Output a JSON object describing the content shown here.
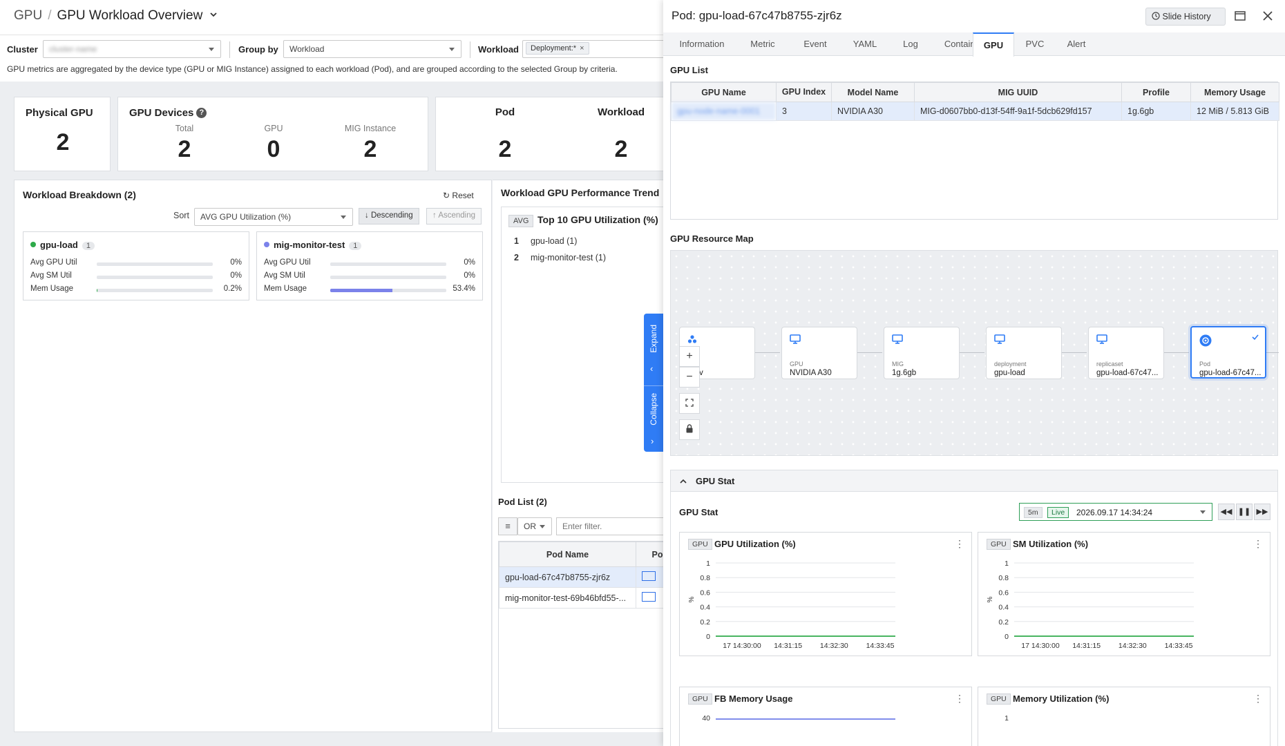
{
  "breadcrumb": {
    "root": "GPU",
    "separator": "/",
    "current": "GPU Workload Overview"
  },
  "filters": {
    "cluster_label": "Cluster",
    "cluster_value": "cluster-name",
    "groupby_label": "Group by",
    "groupby_value": "Workload",
    "workload_label": "Workload",
    "workload_chip": "Deployment:*",
    "chip_close": "×"
  },
  "description": "GPU metrics are aggregated by the device type (GPU or MIG Instance) assigned to each workload (Pod), and are grouped according to the selected Group by criteria.",
  "summary": {
    "physical_gpu": {
      "title": "Physical GPU",
      "value": "2"
    },
    "gpu_devices": {
      "title": "GPU Devices",
      "help": "?",
      "items": [
        {
          "label": "Total",
          "value": "2"
        },
        {
          "label": "GPU",
          "value": "0"
        },
        {
          "label": "MIG Instance",
          "value": "2"
        }
      ]
    },
    "pod": {
      "title": "Pod",
      "value": "2"
    },
    "workload": {
      "title": "Workload",
      "value": "2"
    }
  },
  "breakdown": {
    "title": "Workload Breakdown (2)",
    "reset": "Reset",
    "sort_label": "Sort",
    "sort_value": "AVG GPU Utilization (%)",
    "descending": "Descending",
    "ascending": "Ascending",
    "cards": [
      {
        "name": "gpu-load",
        "count": "1",
        "dot_color": "#2eaa4a",
        "metrics": [
          {
            "label": "Avg GPU Util",
            "value": "0%",
            "fraction": 0.0
          },
          {
            "label": "Avg SM Util",
            "value": "0%",
            "fraction": 0.0
          },
          {
            "label": "Mem Usage",
            "value": "0.2%",
            "fraction": 0.006
          }
        ]
      },
      {
        "name": "mig-monitor-test",
        "count": "1",
        "dot_color": "#7b82ea",
        "metrics": [
          {
            "label": "Avg GPU Util",
            "value": "0%",
            "fraction": 0.0
          },
          {
            "label": "Avg SM Util",
            "value": "0%",
            "fraction": 0.0
          },
          {
            "label": "Mem Usage",
            "value": "53.4%",
            "fraction": 0.534
          }
        ]
      }
    ]
  },
  "trend": {
    "title": "Workload GPU Performance Trend",
    "avg_tag": "AVG",
    "subtitle": "Top 10 GPU Utilization (%)",
    "items": [
      {
        "rank": "1",
        "name": "gpu-load (1)"
      },
      {
        "rank": "2",
        "name": "mig-monitor-test (1)"
      }
    ]
  },
  "side_tabs": {
    "expand": "Expand",
    "collapse": "Collapse"
  },
  "pod_list": {
    "title": "Pod List (2)",
    "logic": "OR",
    "filter_placeholder": "Enter filter.",
    "columns": [
      "Pod Name",
      "Po"
    ],
    "rows": [
      "gpu-load-67c47b8755-zjr6z",
      "mig-monitor-test-69b46bfd55-..."
    ]
  },
  "drawer": {
    "title": "Pod: gpu-load-67c47b8755-zjr6z",
    "slide_history": "Slide History",
    "tabs": [
      "Information",
      "Metric",
      "Event",
      "YAML",
      "Log",
      "Container",
      "GPU",
      "PVC",
      "Alert"
    ],
    "active_tab": "GPU",
    "gpu_list": {
      "title": "GPU List",
      "columns": [
        "GPU Name",
        "GPU Index",
        "Model Name",
        "MIG UUID",
        "Profile",
        "Memory Usage"
      ],
      "rows": [
        [
          "gpu-node-name-0001",
          "3",
          "NVIDIA A30",
          "MIG-d0607bb0-d13f-54ff-9a1f-5dcb629fd157",
          "1g.6gb",
          "12 MiB / 5.813 GiB"
        ]
      ]
    },
    "resource_map": {
      "title": "GPU Resource Map",
      "nodes": [
        {
          "label": "",
          "value": "v",
          "icon": "cluster-icon"
        },
        {
          "label": "GPU",
          "value": "NVIDIA A30",
          "icon": "monitor-icon"
        },
        {
          "label": "MIG",
          "value": "1g.6gb",
          "icon": "monitor-icon"
        },
        {
          "label": "deployment",
          "value": "gpu-load",
          "icon": "monitor-icon"
        },
        {
          "label": "replicaset",
          "value": "gpu-load-67c47...",
          "icon": "monitor-icon"
        },
        {
          "label": "Pod",
          "value": "gpu-load-67c47...",
          "icon": "kubernetes-icon"
        }
      ],
      "zoom_in": "+",
      "zoom_out": "−"
    },
    "gpu_stat": {
      "section_title": "GPU Stat",
      "inner_title": "GPU Stat",
      "range": "5m",
      "live": "Live",
      "time": "2026.09.17 14:34:24",
      "charts": [
        {
          "tag": "GPU",
          "title": "GPU Utilization (%)"
        },
        {
          "tag": "GPU",
          "title": "SM Utilization (%)"
        },
        {
          "tag": "GPU",
          "title": "FB Memory Usage"
        },
        {
          "tag": "GPU",
          "title": "Memory Utilization (%)"
        }
      ]
    }
  },
  "chart_data": [
    {
      "type": "line",
      "title": "GPU Utilization (%)",
      "ylabel": "%",
      "ylim": [
        0,
        1
      ],
      "yticks": [
        "1",
        "0.8",
        "0.6",
        "0.4",
        "0.2",
        "0"
      ],
      "xticks": [
        "17 14:30:00",
        "14:31:15",
        "14:32:30",
        "14:33:45"
      ],
      "series": [
        {
          "color": "#2eaa4a",
          "values": [
            0,
            0,
            0,
            0,
            0,
            0
          ]
        }
      ]
    },
    {
      "type": "line",
      "title": "SM Utilization (%)",
      "ylabel": "%",
      "ylim": [
        0,
        1
      ],
      "yticks": [
        "1",
        "0.8",
        "0.6",
        "0.4",
        "0.2",
        "0"
      ],
      "xticks": [
        "17 14:30:00",
        "14:31:15",
        "14:32:30",
        "14:33:45"
      ],
      "series": [
        {
          "color": "#2eaa4a",
          "values": [
            0,
            0,
            0,
            0,
            0,
            0
          ]
        }
      ]
    },
    {
      "type": "line",
      "title": "FB Memory Usage",
      "yticks": [
        "40"
      ],
      "series": [
        {
          "color": "#6f7de8",
          "values": [
            40,
            40,
            40,
            40,
            40,
            40
          ]
        }
      ]
    },
    {
      "type": "line",
      "title": "Memory Utilization (%)",
      "yticks": [
        "1"
      ],
      "series": []
    }
  ]
}
